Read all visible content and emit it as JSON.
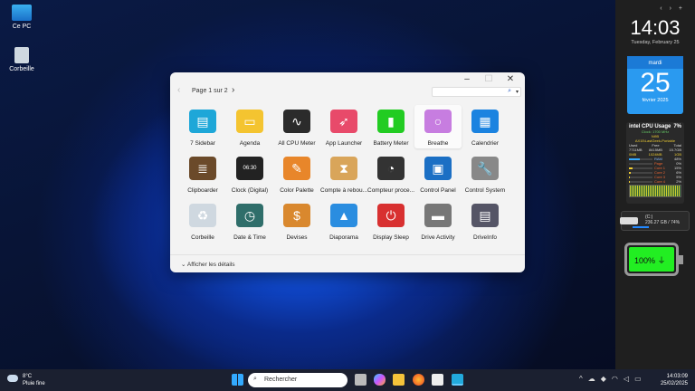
{
  "desktop": {
    "icons": [
      {
        "label": "Ce PC"
      },
      {
        "label": "Corbeille"
      }
    ]
  },
  "window": {
    "minimize": "–",
    "maximize": "☐",
    "close": "✕",
    "prev": "‹",
    "next": "›",
    "page": "Page 1 sur 2",
    "search_icon": "⌕",
    "search_dropdown": "▾",
    "details": "Afficher les détails",
    "details_chevron": "⌄",
    "gadgets": [
      {
        "label": "7 Sidebar",
        "color": "#1ea7d8",
        "glyph": "▤"
      },
      {
        "label": "Agenda",
        "color": "#f4c430",
        "glyph": "▭"
      },
      {
        "label": "All CPU Meter",
        "color": "#2b2b2b",
        "glyph": "∿"
      },
      {
        "label": "App Launcher",
        "color": "#e84a6a",
        "glyph": "➶"
      },
      {
        "label": "Battery Meter",
        "color": "#22cc22",
        "glyph": "▮"
      },
      {
        "label": "Breathe",
        "color": "#c77de0",
        "glyph": "○"
      },
      {
        "label": "Calendrier",
        "color": "#1b83e0",
        "glyph": "▦"
      },
      {
        "label": "Clipboarder",
        "color": "#6b4a2a",
        "glyph": "≣"
      },
      {
        "label": "Clock (Digital)",
        "color": "#222",
        "glyph": "06:30"
      },
      {
        "label": "Color Palette",
        "color": "#e8862a",
        "glyph": "✎"
      },
      {
        "label": "Compte à rebou...",
        "color": "#d9a55a",
        "glyph": "⧗"
      },
      {
        "label": "Compteur proce...",
        "color": "#333",
        "glyph": "◔"
      },
      {
        "label": "Control Panel",
        "color": "#1b6fc4",
        "glyph": "▣"
      },
      {
        "label": "Control System",
        "color": "#888",
        "glyph": "🔧"
      },
      {
        "label": "Corbeille",
        "color": "#cfd8e0",
        "glyph": "♻"
      },
      {
        "label": "Date & Time",
        "color": "#2f6e6a",
        "glyph": "◷"
      },
      {
        "label": "Devises",
        "color": "#d9882e",
        "glyph": "$"
      },
      {
        "label": "Diaporama",
        "color": "#2a8de0",
        "glyph": "▲"
      },
      {
        "label": "Display Sleep",
        "color": "#d83030",
        "glyph": "⏻"
      },
      {
        "label": "Drive Activity",
        "color": "#777",
        "glyph": "▬"
      },
      {
        "label": "DriveInfo",
        "color": "#556",
        "glyph": "▤"
      }
    ]
  },
  "sidebar": {
    "controls": [
      "‹",
      "›",
      "+"
    ],
    "clock": {
      "time": "14:03",
      "date": "Tuesday, February 25"
    },
    "calendar": {
      "weekday": "mardi",
      "day": "25",
      "month_year": "février 2025"
    },
    "cpu": {
      "brand": "intel",
      "title": "CPU Usage",
      "percent": "7%",
      "clock": "Clock: 1700 MHz",
      "line2": "Ni95",
      "host": "AX15\\LastGeek-Portable",
      "mem_headers": [
        "Used",
        "Free",
        "Total"
      ],
      "mem": [
        "7711MB",
        "8415MB",
        "15.7GB"
      ],
      "swap": [
        "0MB",
        "1024MB",
        "1GB"
      ],
      "rows": [
        [
          "RAM",
          "48%"
        ],
        [
          "Page",
          "0%"
        ],
        [
          "Core 1",
          "15%"
        ],
        [
          "Core 2",
          "6%"
        ],
        [
          "Core 3",
          "5%"
        ],
        [
          "Core 4",
          "2%"
        ]
      ]
    },
    "drive": {
      "name": "(C:)",
      "info": "236.27 GB / 74%",
      "fill": 0.74
    },
    "battery": {
      "percent": "100%",
      "level": 1.0
    }
  },
  "taskbar": {
    "weather": {
      "temp": "8°C",
      "desc": "Pluie fine"
    },
    "search": "Rechercher",
    "time": "14:03:09",
    "date": "25/02/2025",
    "tray_chevron": "^"
  }
}
